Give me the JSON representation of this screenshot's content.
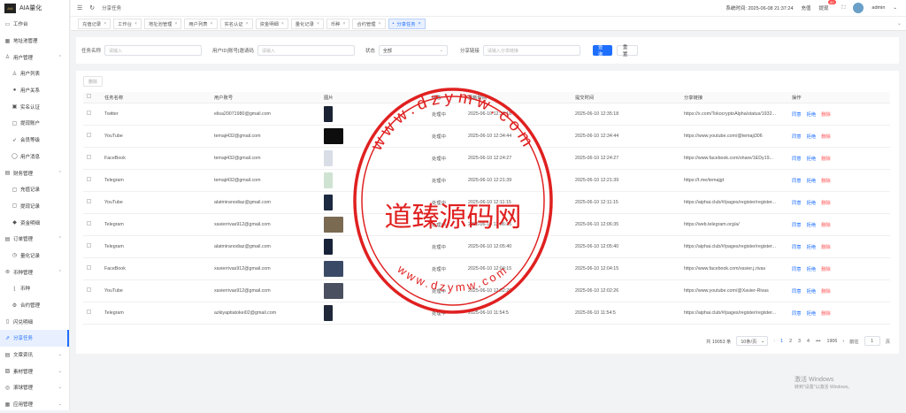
{
  "app": {
    "logo_text": "AIA量化",
    "logo_mark": "AIA"
  },
  "sidebar": {
    "items": [
      {
        "label": "工作台",
        "icon": "monitor-icon",
        "sub": false
      },
      {
        "label": "地址池管理",
        "icon": "grid-icon",
        "sub": false
      },
      {
        "label": "用户管理",
        "icon": "user-icon",
        "sub": false,
        "expand": "up"
      },
      {
        "label": "用户列表",
        "icon": "user-icon",
        "sub": true
      },
      {
        "label": "用户关系",
        "icon": "person-icon",
        "sub": true
      },
      {
        "label": "实名认证",
        "icon": "id-card-icon",
        "sub": true
      },
      {
        "label": "提现账户",
        "icon": "folder-icon",
        "sub": true
      },
      {
        "label": "会员等级",
        "icon": "rocket-icon",
        "sub": true
      },
      {
        "label": "用户消息",
        "icon": "chat-icon",
        "sub": true
      },
      {
        "label": "财务管理",
        "icon": "wallet-icon",
        "sub": false,
        "expand": "up"
      },
      {
        "label": "充值记录",
        "icon": "folder-icon",
        "sub": true
      },
      {
        "label": "提现记录",
        "icon": "folder-icon",
        "sub": true
      },
      {
        "label": "资金明细",
        "icon": "cube-icon",
        "sub": true
      },
      {
        "label": "订单管理",
        "icon": "order-icon",
        "sub": false,
        "expand": "up"
      },
      {
        "label": "量化记录",
        "icon": "clock-icon",
        "sub": true
      },
      {
        "label": "币种管理",
        "icon": "coin-icon",
        "sub": false,
        "expand": "up"
      },
      {
        "label": "币种",
        "icon": "chart-icon",
        "sub": true
      },
      {
        "label": "合约管理",
        "icon": "settings-icon",
        "sub": true
      },
      {
        "label": "闪兑明细",
        "icon": "doc-icon",
        "sub": false
      },
      {
        "label": "分享任务",
        "icon": "share-icon",
        "sub": false,
        "active": true
      },
      {
        "label": "文章资讯",
        "icon": "article-icon",
        "sub": false,
        "expand": "down"
      },
      {
        "label": "素材管理",
        "icon": "image-icon",
        "sub": false,
        "expand": "down"
      },
      {
        "label": "滚球管理",
        "icon": "ball-icon",
        "sub": false,
        "expand": "down"
      },
      {
        "label": "应用管理",
        "icon": "app-icon",
        "sub": false,
        "expand": "down"
      }
    ]
  },
  "topbar": {
    "breadcrumb": "分享任务",
    "system_time_label": "系统时间:",
    "system_time": "2025-06-08 21:37:24",
    "recharge": "充值",
    "withdraw": "提现",
    "badge_count": "80",
    "username": "admin"
  },
  "tabs": [
    {
      "label": "充值记录"
    },
    {
      "label": "工作台"
    },
    {
      "label": "地址池管理"
    },
    {
      "label": "用户列表"
    },
    {
      "label": "实名认证"
    },
    {
      "label": "资金明细"
    },
    {
      "label": "量化记录"
    },
    {
      "label": "币种"
    },
    {
      "label": "合约管理"
    },
    {
      "label": "分享任务",
      "active": true
    }
  ],
  "filters": {
    "task_name_label": "任务名称",
    "task_name_placeholder": "请输入",
    "user_label": "用户ID|账号|邀请码",
    "user_placeholder": "请输入",
    "status_label": "状态",
    "status_value": "全部",
    "link_label": "分享链接",
    "link_placeholder": "请输入分享链接",
    "query_button": "查询",
    "reset_button": "重置"
  },
  "table": {
    "delete_button": "删除",
    "columns": [
      "任务名称",
      "用户账号",
      "图片",
      "状态",
      "更新时间",
      "提交时间",
      "分享链接",
      "操作"
    ],
    "rows": [
      {
        "task": "Twitter",
        "account": "elisa20071980@gmail.com",
        "status": "处理中",
        "updated": "2025-06-10 12:35:18",
        "submitted": "2025-06-10 12:35:18",
        "link": "https://x.com/TokocryptoAlpha/status/1932...",
        "thumb": "#1a2233",
        "wide": false
      },
      {
        "task": "YouTube",
        "account": "temaji432@gmail.com",
        "status": "处理中",
        "updated": "2025-06-10 12:34:44",
        "submitted": "2025-06-10 12:34:44",
        "link": "https://www.youtube.com/@temaji306",
        "thumb": "#0d0d0d",
        "wide": true
      },
      {
        "task": "FaceBook",
        "account": "temaji432@gmail.com",
        "status": "处理中",
        "updated": "2025-06-10 12:24:27",
        "submitted": "2025-06-10 12:24:27",
        "link": "https://www.facebook.com/share/1EDy19...",
        "thumb": "#d8dde6",
        "wide": false
      },
      {
        "task": "Telegram",
        "account": "temaji432@gmail.com",
        "status": "处理中",
        "updated": "2025-06-10 12:21:39",
        "submitted": "2025-06-10 12:21:39",
        "link": "https://t.me/temajgt",
        "thumb": "#cfe3d2",
        "wide": false
      },
      {
        "task": "YouTube",
        "account": "alatmiranodiaz@gmail.com",
        "status": "处理中",
        "updated": "2025-06-10 12:11:15",
        "submitted": "2025-06-10 12:11:15",
        "link": "https://aiphai.club/#/pages/register/register...",
        "thumb": "#1d2940",
        "wide": false
      },
      {
        "task": "Telegram",
        "account": "xavierrivas912@gmail.com",
        "status": "处理中",
        "updated": "2025-06-10 12:06:35",
        "submitted": "2025-06-10 12:06:35",
        "link": "https://web.telegram.org/a/",
        "thumb": "#7a6a52",
        "wide": true
      },
      {
        "task": "Telegram",
        "account": "alatmiranodiaz@gmail.com",
        "status": "处理中",
        "updated": "2025-06-10 12:05:40",
        "submitted": "2025-06-10 12:05:40",
        "link": "https://aiphai.club/#/pages/register/register...",
        "thumb": "#18233a",
        "wide": false
      },
      {
        "task": "FaceBook",
        "account": "xavierrivas912@gmail.com",
        "status": "处理中",
        "updated": "2025-06-10 12:04:15",
        "submitted": "2025-06-10 12:04:15",
        "link": "https://www.facebook.com/xavier.j.rivas",
        "thumb": "#3a4a66",
        "wide": true
      },
      {
        "task": "YouTube",
        "account": "xavierrivas912@gmail.com",
        "status": "处理中",
        "updated": "2025-06-10 12:02:26",
        "submitted": "2025-06-10 12:02:26",
        "link": "https://www.youtube.com/@Xavier-Rivas",
        "thumb": "#4a5060",
        "wide": true
      },
      {
        "task": "Telegram",
        "account": "azkiyaptiatokei02@gmail.com",
        "status": "处理中",
        "updated": "2025-06-10 11:54:5",
        "submitted": "2025-06-10 11:54:5",
        "link": "https://aiphai.club/#/pages/register/register...",
        "thumb": "#20283a",
        "wide": false
      }
    ],
    "op_approve": "同意",
    "op_reject": "拒绝",
    "op_delete": "删除"
  },
  "pagination": {
    "total": "共 19053 条",
    "page_size": "10条/页",
    "prev": "‹",
    "pages": [
      "1",
      "2",
      "3",
      "4",
      "•••",
      "1906"
    ],
    "active_page": "1",
    "next": "›",
    "goto_label": "前往",
    "goto_value": "1",
    "goto_suffix": "页"
  },
  "watermark": {
    "main": "道臻源码网",
    "url_top": "www.dzymw.com",
    "url_bottom": "www.dzymw.com"
  },
  "windows_activation": {
    "title": "激活 Windows",
    "subtitle": "转到\"设置\"以激活 Windows。"
  }
}
